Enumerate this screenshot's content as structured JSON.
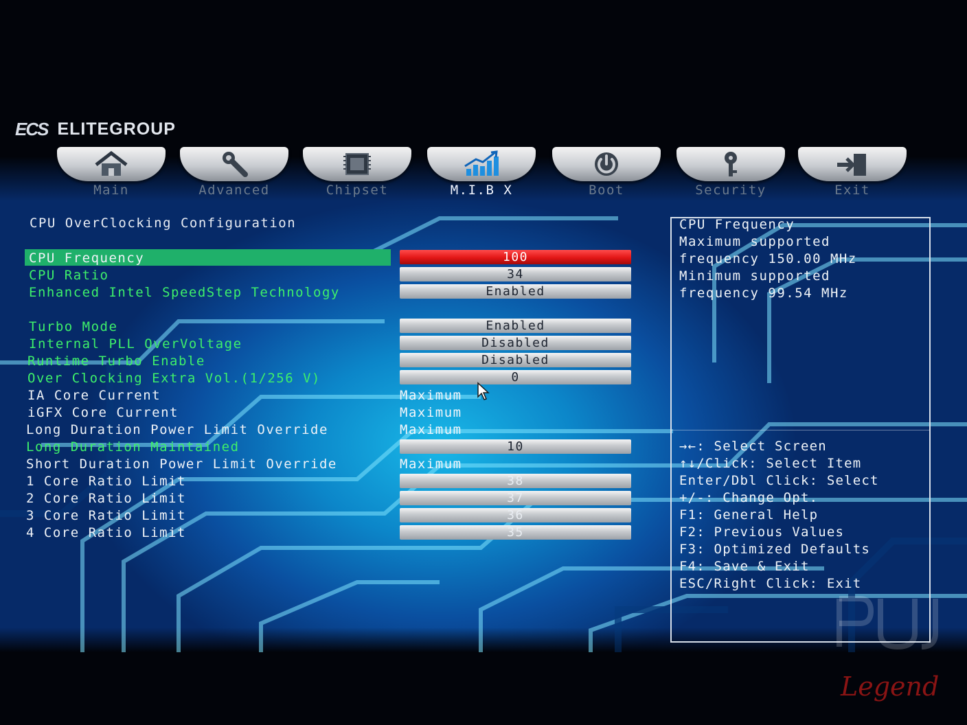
{
  "brand": {
    "mark": "ECS",
    "name": "ELITEGROUP"
  },
  "tabs": [
    {
      "label": "Main",
      "icon": "home-icon",
      "active": false
    },
    {
      "label": "Advanced",
      "icon": "wrench-icon",
      "active": false
    },
    {
      "label": "Chipset",
      "icon": "chip-icon",
      "active": false
    },
    {
      "label": "M.I.B X",
      "icon": "chart-up-icon",
      "active": true
    },
    {
      "label": "Boot",
      "icon": "power-icon",
      "active": false
    },
    {
      "label": "Security",
      "icon": "key-icon",
      "active": false
    },
    {
      "label": "Exit",
      "icon": "exit-door-icon",
      "active": false
    }
  ],
  "section_title": "CPU OverClocking Configuration",
  "settings": [
    {
      "label": "CPU Frequency",
      "value": "100",
      "selected": true
    },
    {
      "label": "CPU Ratio",
      "value": "34"
    },
    {
      "label": "Enhanced Intel SpeedStep Technology",
      "value": "Enabled"
    },
    {
      "label": "Turbo Mode",
      "value": "Enabled"
    },
    {
      "label": "Internal PLL OverVoltage",
      "value": "Disabled"
    },
    {
      "label": "Runtime Turbo Enable",
      "value": "Disabled"
    },
    {
      "label": "Over Clocking Extra Vol.(1/256 V)",
      "value": "0"
    },
    {
      "label": "IA Core Current",
      "value": "Maximum"
    },
    {
      "label": "iGFX Core Current",
      "value": "Maximum"
    },
    {
      "label": "Long Duration Power Limit Override",
      "value": "Maximum"
    },
    {
      "label": "Long Duration Maintained",
      "value": "10"
    },
    {
      "label": "Short Duration Power Limit Override",
      "value": "Maximum"
    },
    {
      "label": "1 Core Ratio Limit",
      "value": "38"
    },
    {
      "label": "2 Core Ratio Limit",
      "value": "37"
    },
    {
      "label": "3 Core Ratio Limit",
      "value": "36"
    },
    {
      "label": "4 Core Ratio Limit",
      "value": "35"
    }
  ],
  "help": {
    "lines": [
      "CPU Frequency",
      "Maximum supported",
      "frequency 150.00 MHz",
      "Minimum supported",
      "frequency 99.54 MHz"
    ],
    "keys": [
      "→←: Select Screen",
      "↑↓/Click: Select Item",
      "Enter/Dbl Click: Select",
      "+/-: Change Opt.",
      "F1: General Help",
      "F2: Previous Values",
      "F3: Optimized Defaults",
      "F4: Save & Exit",
      "ESC/Right Click: Exit"
    ]
  },
  "watermark": {
    "text": "Legend"
  }
}
